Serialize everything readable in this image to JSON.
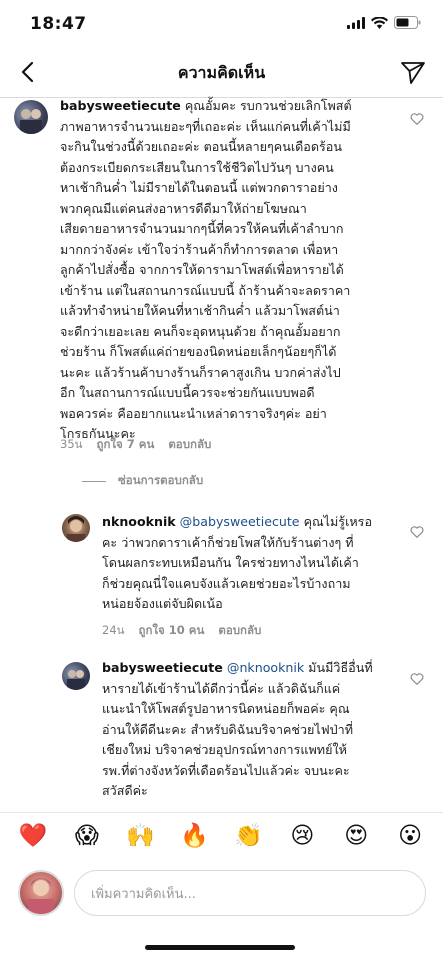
{
  "status": {
    "time": "18:47"
  },
  "nav": {
    "title": "ความคิดเห็น"
  },
  "comments": [
    {
      "username": "babysweetiecute",
      "text": "คุณอั้มคะ รบกวนช่วยเลิกโพสต์\nภาพอาหารจำนวนเยอะๆที่เถอะค่ะ เห็นแก่คนที่เค้าไม่มี\nจะกินในช่วงนี้ด้วยเถอะค่ะ ตอนนี้หลายๆคนเดือดร้อน\nต้องกระเบียดกระเสียนในการใช้ชีวิตไปวันๆ บางคน\nหาเช้ากินค่ำ ไม่มีรายได้ในตอนนี้ แต่พวกดาราอย่าง\nพวกคุณมีแต่คนส่งอาหารดีดีมาให้ถ่ายโฆษณา\nเสียดายอาหารจำนวนมากๆนี้ที่ควรให้คนที่เค้าลำบาก\nมากกว่าจังค่ะ เข้าใจว่าร้านค้าก็ทำการตลาด เพื่อหา\nลูกค้าไปสั่งซื้อ จากการให้ดารามาโพสต์เพื่อหารายได้\nเข้าร้าน แต่ในสถานการณ์แบบนี้ ถ้าร้านค้าจะลดราคา\nแล้วทำจำหน่ายให้คนที่หาเช้ากินค่ำ แล้วมาโพสต์น่า\nจะดีกว่าเยอะเลย คนก็จะอุดหนุนด้วย ถ้าคุณอั้มอยาก\nช่วยร้าน ก็โพสต์แค่ถ่ายของนิดหน่อยเล็กๆน้อยๆก็ได้\nนะคะ แล้วร้านค้าบางร้านก็ราคาสูงเกิน บวกค่าส่งไป\nอีก ในสถานการณ์แบบนี้ควรจะช่วยกันแบบพอดี\nพอควรค่ะ คืออยากแนะนำเหล่าดาราจริงๆค่ะ อย่า\nโกรธกันนะคะ",
      "time": "35น",
      "likes": "ถูกใจ 7 คน",
      "reply": "ตอบกลับ"
    },
    {
      "username": "nknooknik",
      "mention": "@babysweetiecute",
      "text": " คุณไม่รู้เหรอ\nคะ ว่าพวกดาราเค้าก็ช่วยโพสให้กับร้านต่างๆ ที่\nโดนผลกระทบเหมือนกัน ใครช่วยทางไหนได้เค้า\nก็ช่วยคุณนี่ใจแคบจังแล้วเคยช่วยอะไรบ้างถาม\nหน่อยจ้องแต่จับผิดเน้อ",
      "time": "24น",
      "likes": "ถูกใจ 10 คน",
      "reply": "ตอบกลับ"
    },
    {
      "username": "babysweetiecute",
      "mention": "@nknooknik",
      "text": " มันมีวิธีอื่นที่\nหารายได้เข้าร้านได้ดีกว่านี้ค่ะ แล้วดิฉันก็แค่\nแนะนำให้โพสต์รูปอาหารนิดหน่อยก็พอค่ะ คุณ\nอ่านให้ดีดีนะคะ สำหรับดิฉันบริจาคช่วยไฟป่าที่\nเชียงใหม่ บริจาคช่วยอุปกรณ์ทางการแพทย์ให้\nรพ.ที่ต่างจังหวัดที่เดือดร้อนไปแล้วค่ะ จบนะคะ\nสวัสดีค่ะ"
    }
  ],
  "hide_replies": "ซ่อนการตอบกลับ",
  "emojis": [
    "❤️",
    "😱",
    "🙌",
    "🔥",
    "👏",
    "😢",
    "😍",
    "😮"
  ],
  "input": {
    "placeholder": "เพิ่มความคิดเห็น..."
  }
}
